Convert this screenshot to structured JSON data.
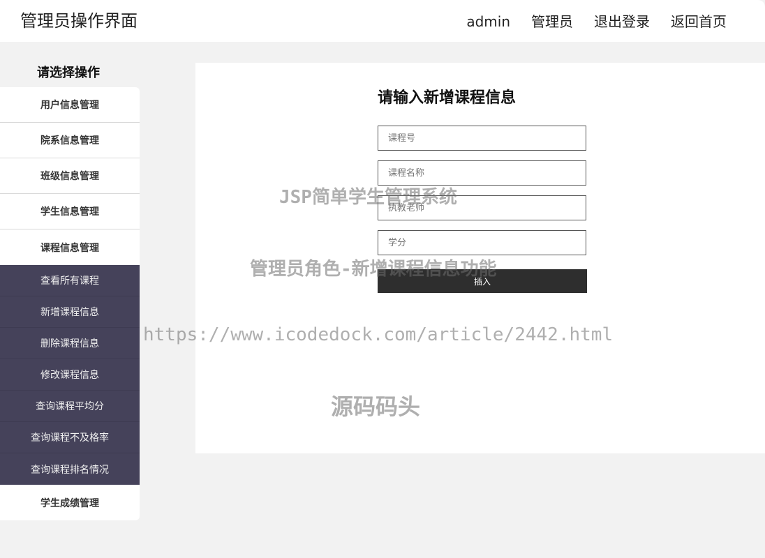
{
  "header": {
    "title": "管理员操作界面",
    "nav": [
      "admin",
      "管理员",
      "退出登录",
      "返回首页"
    ]
  },
  "sidebar": {
    "heading": "请选择操作",
    "items": [
      "用户信息管理",
      "院系信息管理",
      "班级信息管理",
      "学生信息管理",
      "课程信息管理"
    ],
    "submenu": [
      "查看所有课程",
      "新增课程信息",
      "删除课程信息",
      "修改课程信息",
      "查询课程平均分",
      "查询课程不及格率",
      "查询课程排名情况"
    ],
    "last_item": "学生成绩管理"
  },
  "form": {
    "title": "请输入新增课程信息",
    "fields": [
      {
        "placeholder": "课程号"
      },
      {
        "placeholder": "课程名称"
      },
      {
        "placeholder": "执教老师"
      },
      {
        "placeholder": "学分"
      }
    ],
    "submit_label": "插入"
  },
  "watermarks": {
    "line1": "JSP简单学生管理系统",
    "line2": "管理员角色-新增课程信息功能",
    "line3": "https://www.icodedock.com/article/2442.html",
    "line4": "源码码头"
  },
  "colors": {
    "submenu_bg": "#45425a",
    "button_bg": "#2e2e2e",
    "page_bg": "#f2f2f2"
  }
}
